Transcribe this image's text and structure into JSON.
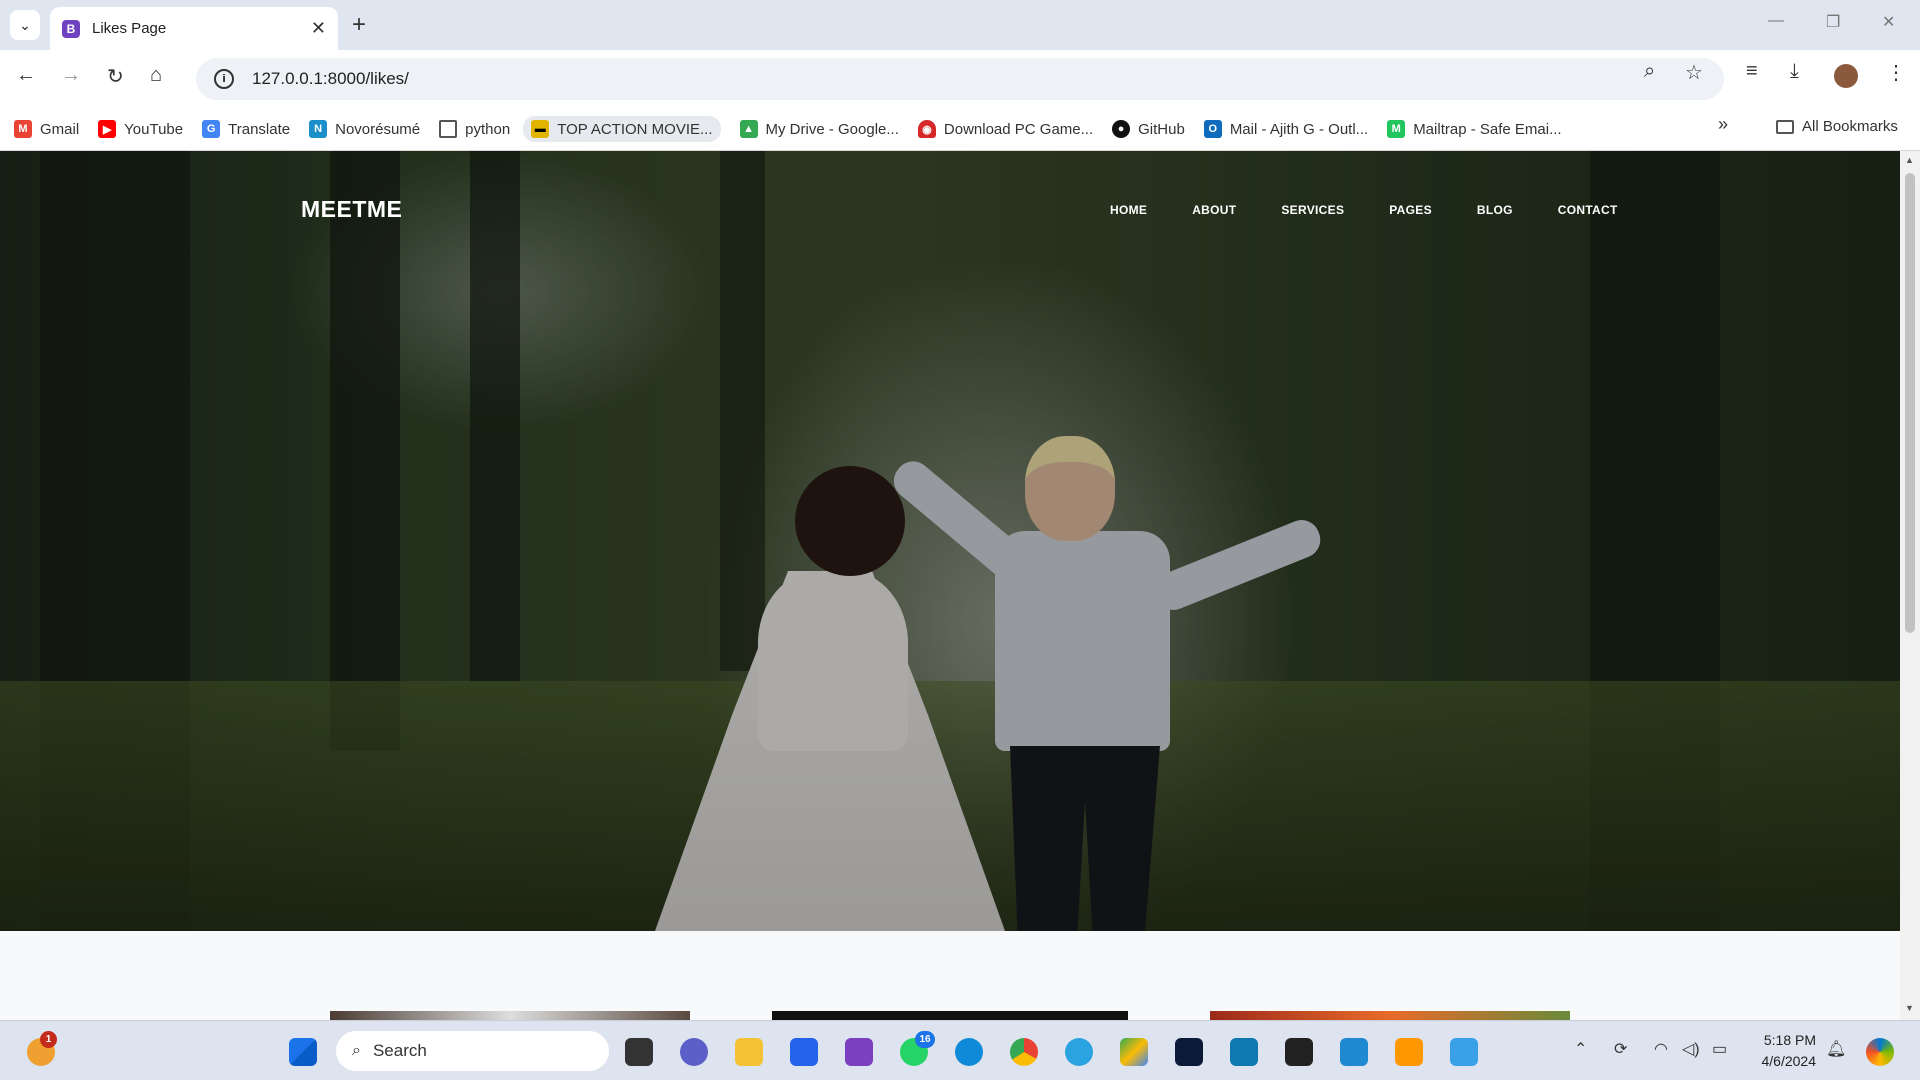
{
  "browser": {
    "tab_title": "Likes Page",
    "tab_favicon": "B",
    "url": "127.0.0.1:8000/likes/",
    "bookmarks": [
      {
        "label": "Gmail",
        "icon": "gmail-icon",
        "color": "#ea4335"
      },
      {
        "label": "YouTube",
        "icon": "youtube-icon",
        "color": "#ff0000"
      },
      {
        "label": "Translate",
        "icon": "translate-icon",
        "color": "#4285f4"
      },
      {
        "label": "Novorésumé",
        "icon": "novoresume-icon",
        "color": "#1a8fc9"
      },
      {
        "label": "python",
        "icon": "folder-icon",
        "color": "#555555"
      },
      {
        "label": "TOP ACTION MOVIE...",
        "icon": "movie-icon",
        "color": "#e0b400"
      },
      {
        "label": "My Drive - Google...",
        "icon": "drive-icon",
        "color": "#34a853"
      },
      {
        "label": "Download PC Game...",
        "icon": "game-icon",
        "color": "#d62828"
      },
      {
        "label": "GitHub",
        "icon": "github-icon",
        "color": "#111111"
      },
      {
        "label": "Mail - Ajith G - Outl...",
        "icon": "outlook-icon",
        "color": "#0f6cbd"
      },
      {
        "label": "Mailtrap - Safe Emai...",
        "icon": "mailtrap-icon",
        "color": "#22c55e"
      }
    ],
    "all_bookmarks": "All Bookmarks"
  },
  "site": {
    "brand": "MEETME",
    "menu": [
      "HOME",
      "ABOUT",
      "SERVICES",
      "PAGES",
      "BLOG",
      "CONTACT"
    ]
  },
  "taskbar": {
    "search_placeholder": "Search",
    "time": "5:18 PM",
    "date": "4/6/2024",
    "weather_badge": "1",
    "whatsapp_badge": "16"
  }
}
